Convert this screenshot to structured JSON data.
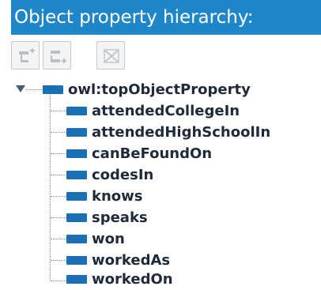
{
  "header": {
    "title": "Object property hierarchy:"
  },
  "toolbar": {
    "buttons": [
      {
        "name": "add-sub-property",
        "icon": "add-subproperty-icon",
        "enabled": false
      },
      {
        "name": "add-sibling-property",
        "icon": "add-sibling-property-icon",
        "enabled": false
      },
      {
        "name": "delete-property",
        "icon": "delete-property-icon",
        "enabled": false
      }
    ]
  },
  "tree": {
    "root": {
      "label": "owl:topObjectProperty",
      "expanded": true
    },
    "children": [
      {
        "label": "attendedCollegeIn"
      },
      {
        "label": "attendedHighSchoolIn"
      },
      {
        "label": "canBeFoundOn"
      },
      {
        "label": "codesIn"
      },
      {
        "label": "knows"
      },
      {
        "label": "speaks"
      },
      {
        "label": "won"
      },
      {
        "label": "workedAs"
      },
      {
        "label": "workedOn"
      }
    ]
  },
  "colors": {
    "title_bar": "#1f86c8",
    "title_text": "#ffffff",
    "node_icon": "#1b6fb4",
    "label_text": "#1e2a3a"
  }
}
